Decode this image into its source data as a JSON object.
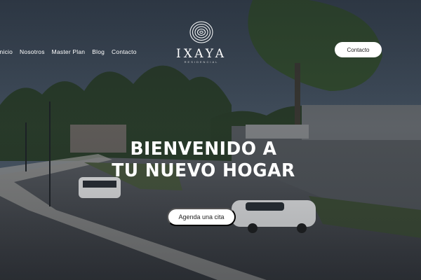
{
  "nav": {
    "items": [
      "Inicio",
      "Nosotros",
      "Master Plan",
      "Blog",
      "Contacto"
    ]
  },
  "brand": {
    "name": "IXAYA",
    "tagline": "RESIDENCIAL"
  },
  "header": {
    "contact_button": "Contacto"
  },
  "hero": {
    "headline_line1": "BIENVENIDO A",
    "headline_line2": "TU NUEVO HOGAR",
    "cta_label": "Agenda una cita"
  },
  "colors": {
    "sky": "#3d4a58",
    "trees": "#2f4a2c",
    "road": "#4a4d52",
    "walls": "#5b5f63",
    "button_bg": "#ffffff"
  }
}
